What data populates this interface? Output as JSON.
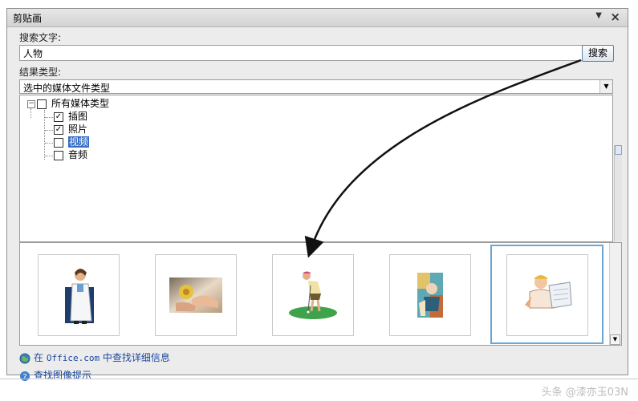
{
  "pane": {
    "title": "剪贴画",
    "search_label": "搜索文字:",
    "search_value": "人物",
    "search_button": "搜索",
    "results_label": "结果类型:",
    "results_type_value": "选中的媒体文件类型",
    "tree": {
      "root": "所有媒体类型",
      "items": [
        {
          "label": "插图",
          "checked": true
        },
        {
          "label": "照片",
          "checked": true
        },
        {
          "label": "视频",
          "checked": false,
          "highlighted": true
        },
        {
          "label": "音频",
          "checked": false
        }
      ]
    },
    "results": [
      {
        "icon": "doctor-clipart-icon"
      },
      {
        "icon": "hands-flower-photo-icon"
      },
      {
        "icon": "golfer-clipart-icon"
      },
      {
        "icon": "abstract-person-clipart-icon"
      },
      {
        "icon": "worker-blueprint-clipart-icon",
        "selected": true
      }
    ],
    "footer": {
      "link1_prefix": "在",
      "link1_mono": "Office.com",
      "link1_suffix": "中查找详细信息",
      "link2": "查找图像提示"
    }
  },
  "watermark": "头条 @漆亦玉03N",
  "colors": {
    "highlight": "#3169c6",
    "link": "#1c47a1",
    "selected_border": "#6aa6d6"
  }
}
